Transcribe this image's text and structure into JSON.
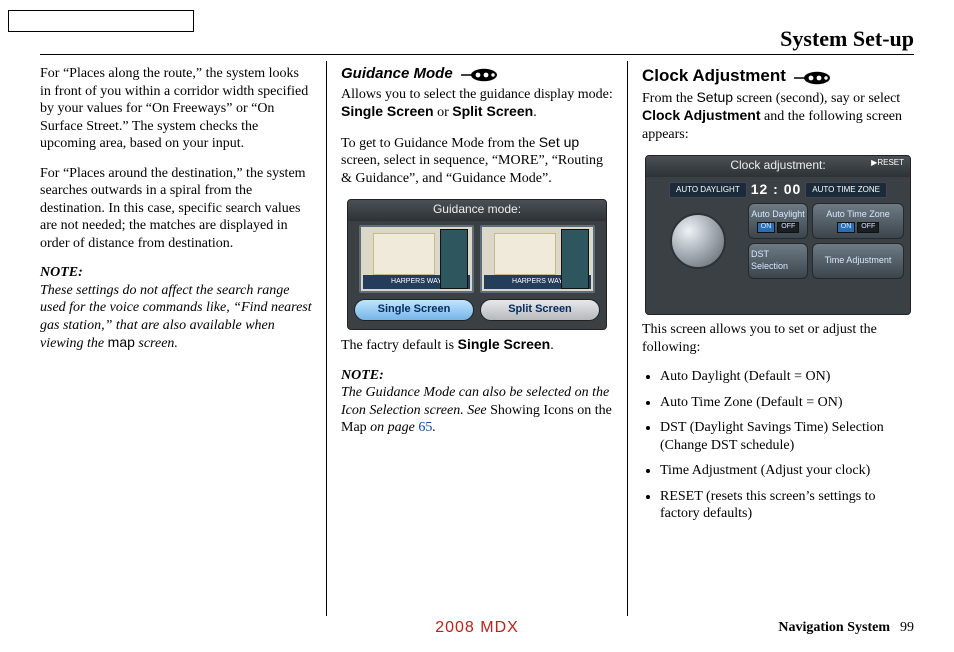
{
  "page_title": "System Set-up",
  "col1": {
    "p1": "For “Places along the route,” the system looks in front of you within a corridor width specified by your values for “On Freeways” or “On Surface Street.” The system checks the upcoming area, based on your input.",
    "p2": "For “Places around the destination,” the system searches outwards in a spiral from the destination. In this case, specific search values are not needed; the matches are displayed in order of distance from destination.",
    "note_head": "NOTE:",
    "note_body_a": "These settings do not affect the search range used for the voice commands like, “Find nearest gas station,” that are also available when viewing the ",
    "note_map": "map",
    "note_body_b": " screen."
  },
  "col2": {
    "heading": "Guidance Mode",
    "p1a": "Allows you to select the guidance display mode: ",
    "p1_single": "Single Screen",
    "p1b": " or ",
    "p1_split": "Split Screen",
    "p1c": ".",
    "p2a": "To get to Guidance Mode from the ",
    "p2_setup": "Set up",
    "p2b": " screen, select in sequence, “MORE”, “Routing & Guidance”, and “Guidance Mode”.",
    "shot": {
      "title": "Guidance mode:",
      "band_label": "HARPERS WAY",
      "btn_single": "Single Screen",
      "btn_split": "Split Screen"
    },
    "p3a": "The factry default is ",
    "p3_single": "Single Screen",
    "p3b": ".",
    "note_head": "NOTE:",
    "note_a": "The Guidance Mode can also be selected on the Icon Selection screen. See ",
    "note_showing": "Showing Icons on the Map",
    "note_b": " on page ",
    "note_page": "65",
    "note_c": "."
  },
  "col3": {
    "heading": "Clock Adjustment",
    "p1a": "From the ",
    "p1_setup": "Setup",
    "p1b": " screen (second), say or select ",
    "p1_clock": "Clock Adjustment",
    "p1c": " and the following screen appears:",
    "shot": {
      "title": "Clock adjustment:",
      "reset": "RESET",
      "tag1": "AUTO DAYLIGHT",
      "tag2": "AUTO TIME ZONE",
      "time": "12 : 00",
      "btn1": "Auto Daylight",
      "btn2": "Auto Time Zone",
      "btn3": "DST Selection",
      "btn4": "Time Adjustment",
      "on": "ON",
      "off": "OFF"
    },
    "p2": "This screen allows you to set or adjust the following:",
    "bullets": [
      "Auto Daylight (Default = ON)",
      "Auto Time Zone (Default = ON)",
      "DST (Daylight Savings Time) Selection (Change DST schedule)",
      "Time Adjustment (Adjust your clock)",
      "RESET (resets this screen’s settings to factory defaults)"
    ]
  },
  "footer": {
    "model": "2008  MDX",
    "section": "Navigation System",
    "page": "99"
  }
}
